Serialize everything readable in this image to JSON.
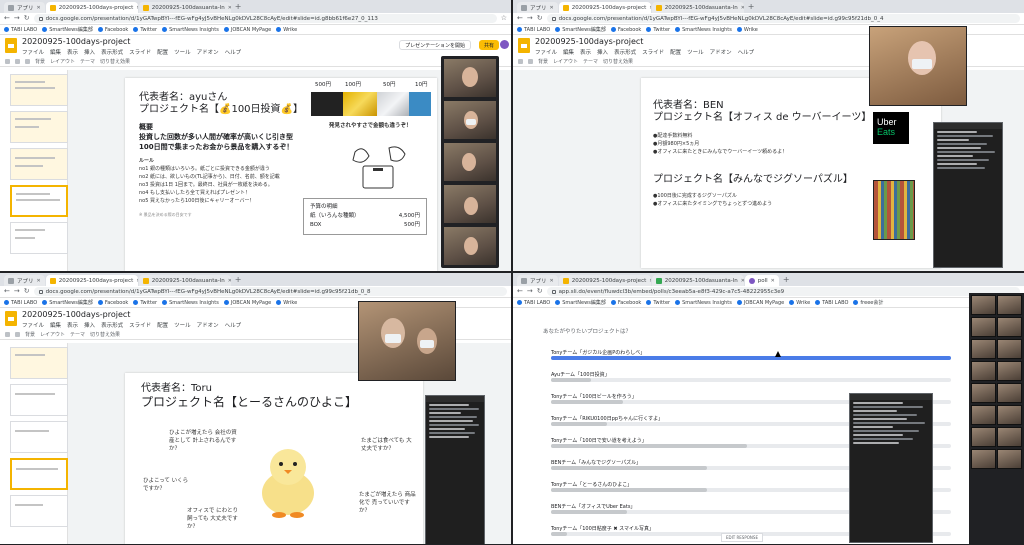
{
  "browser": {
    "apps_label": "アプリ",
    "new_tab": "+",
    "tabs_slides": [
      {
        "title": "20200925-100days-project"
      },
      {
        "title": "20200925-100dasuanta-ln"
      }
    ],
    "url_slides_1": "docs.google.com/presentation/d/1yGATwpBYI---fEG-wFg4yJ5vBHeNLg0kDVL28C8cAyE/edit#slide=id.g8bb61f6e27_0_113",
    "url_slides_2": "docs.google.com/presentation/d/1yGATwpBYI---fEG-wFg4yJ5vBHeNLg0kDVL28C8cAyE/edit#slide=id.g99c95f21db_0_4",
    "url_slides_3": "docs.google.com/presentation/d/1yGATwpBYI---fEG-wFg4yJ5vBHeNLg0kDVL28C8cAyE/edit#slide=id.g99c95f21db_0_8",
    "url_poll": "app.sli.do/event/fluwdcl3b/embed/polls/c3eeab5a-e8f3-429c-a7c5-48222955c3e9",
    "poll_tab": "poll",
    "bookmarks": [
      "TABI LABO",
      "SmartNews編集部",
      "Facebook",
      "Twitter",
      "SmartNews Insights",
      "JOBCAN MyPage",
      "Wrike",
      "TABI LABO",
      "freee会計"
    ]
  },
  "slides_app": {
    "doc_title": "20200925-100days-project",
    "menu": [
      "ファイル",
      "編集",
      "表示",
      "挿入",
      "表示形式",
      "スライド",
      "配置",
      "ツール",
      "アドオン",
      "ヘルプ"
    ],
    "toolbar": [
      "背景",
      "レイアウト",
      "テーマ",
      "切り替え効果"
    ],
    "present_label": "プレゼンテーションを開始",
    "share_label": "共有",
    "user_count": "+12"
  },
  "slide1": {
    "rep": "代表者名：ayuさん",
    "project": "プロジェクト名【💰100日投資💰】",
    "overview_h": "概要",
    "overview_1": "投資した回数が多い人間が確率が高いくじ引き型",
    "overview_2": "100日間で集まったお金から景品を購入するぞ！",
    "prices": [
      "500円",
      "100円",
      "50円",
      "10円"
    ],
    "tagline": "発見されやすさで金額も違うぞ！",
    "rules_h": "ルール",
    "rules": [
      "no1 銀の種類はいろいろ。紙ごとに投資できる金額が違う",
      "no2 紙には、欲しいもの(TL記事から)、日付、名前、額を記載",
      "no3 投資は1日 1回まで。最終日、社員が一枚紙を決める。",
      "no4 もし支払いしたら全て買えればプレゼント！",
      "no5 買えなかったら100日後にキャリーオーバー！"
    ],
    "budget_title": "予算の明細",
    "budget": [
      {
        "item": "紙（いろんな種類）",
        "amount": "4,500円"
      },
      {
        "item": "BOX",
        "amount": "500円"
      }
    ],
    "footnote": "※ 景品を決める際の目安です"
  },
  "slide2": {
    "rep": "代表者名：BEN",
    "project": "プロジェクト名【オフィス de ウーバーイーツ】",
    "bullets": [
      "●配達手数料無料",
      "●月額980円×5ヵ月",
      "●オフィスに来たときにみんなでウーバーイーツ頼めるよ！"
    ],
    "project2": "プロジェクト名【みんなでジグソーパズル】",
    "bullets2": [
      "●100日後に完成するジグソーパズル",
      "●オフィスに来たタイミングでちょっとずつ進めよう"
    ],
    "uber_1": "Uber",
    "uber_2": "Eats"
  },
  "slide3": {
    "rep": "代表者名：Toru",
    "project": "プロジェクト名【とーるさんのひよこ】",
    "q1": "ひよこが増えたら 会社の資産として 計上されるんですか？",
    "q2": "ひよこって いくらですか？",
    "q3": "オフィスで にわとり飼っても 大丈夫ですか？",
    "q4": "たまごは食べても 大丈夫ですか？",
    "q5": "たまごが増えたら 商品化で 売っていいですか？"
  },
  "poll": {
    "question": "あなたがやりたいプロジェクトは？",
    "items": [
      {
        "label": "Tonyチーム「ガジカル企画Pのわらしべ」",
        "pct": 100,
        "winner": true
      },
      {
        "label": "Ayuチーム「100日投資」",
        "pct": 10
      },
      {
        "label": "Tonyチーム「100日ビールを作ろう」",
        "pct": 18
      },
      {
        "label": "Tonyチーム「RIKU0100日ppちゃんに行くすよ」",
        "pct": 14
      },
      {
        "label": "Tonyチーム「100日で安い道を考えよう」",
        "pct": 49
      },
      {
        "label": "BENチーム「みんなでジグソーパズル」",
        "pct": 39
      },
      {
        "label": "Tonyチーム「とーるさんのひよこ」",
        "pct": 39
      },
      {
        "label": "BENチーム「オフィスでUber Eats」",
        "pct": 19
      },
      {
        "label": "Tonyチーム「100日粘度子 ✖ スマイル写真」",
        "pct": 4
      }
    ],
    "edit_label": "EDIT RESPONSE"
  },
  "colors": {
    "accent_slides": "#f4b400",
    "poll_win": "#4a7ce8",
    "poll_bar": "#c6c9cc"
  },
  "icons": [
    "back-icon",
    "forward-icon",
    "reload-icon",
    "lock-icon",
    "star-icon",
    "tab-close-icon"
  ]
}
